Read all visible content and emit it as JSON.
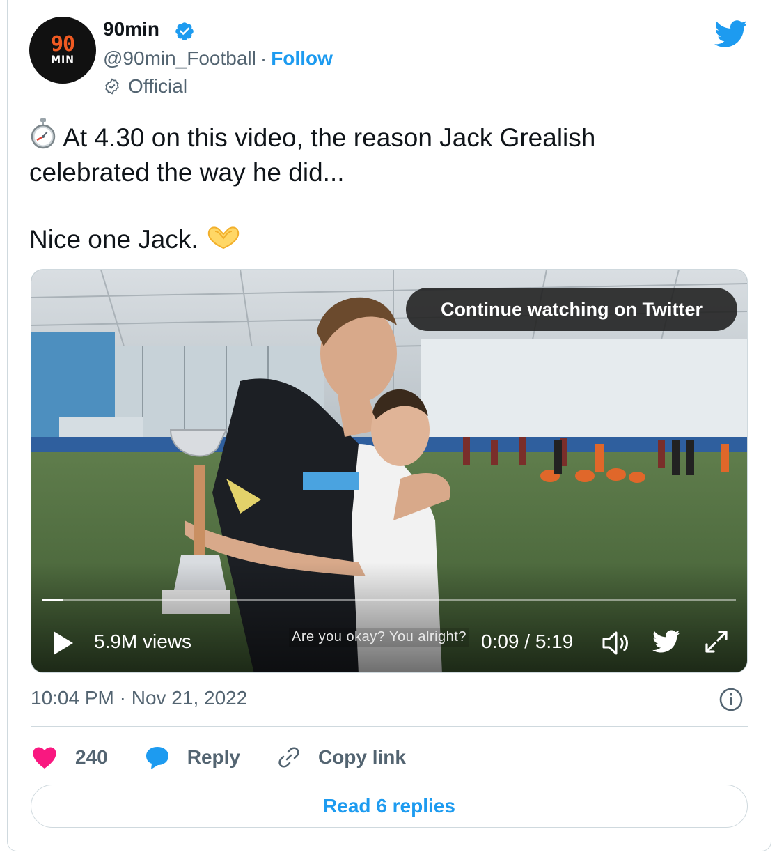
{
  "account": {
    "name": "90min",
    "handle": "@90min_Football",
    "separator": "·",
    "follow_label": "Follow",
    "badge_label": "Official",
    "avatar_logo_line1": "90",
    "avatar_logo_line2": "MIN"
  },
  "tweet": {
    "line1": "At 4.30 on this video, the reason Jack Grealish",
    "line2": "celebrated the way he did...",
    "paragraph2": "Nice one Jack.",
    "emoji_icons": [
      "stopwatch-icon",
      "heart-hands-icon"
    ]
  },
  "video": {
    "overlay_button": "Continue watching on Twitter",
    "views": "5.9M views",
    "caption": "Are you okay? You alright?",
    "timecode": "0:09 / 5:19",
    "progress": 0.029
  },
  "meta": {
    "timestamp": "10:04 PM · Nov 21, 2022"
  },
  "actions": {
    "likes": "240",
    "reply_label": "Reply",
    "copy_link_label": "Copy link"
  },
  "read_replies_label": "Read 6 replies",
  "colors": {
    "brand_blue": "#1d9bf0",
    "like_pink": "#f91880",
    "text_secondary": "#536471",
    "logo_orange": "#f05a22"
  }
}
